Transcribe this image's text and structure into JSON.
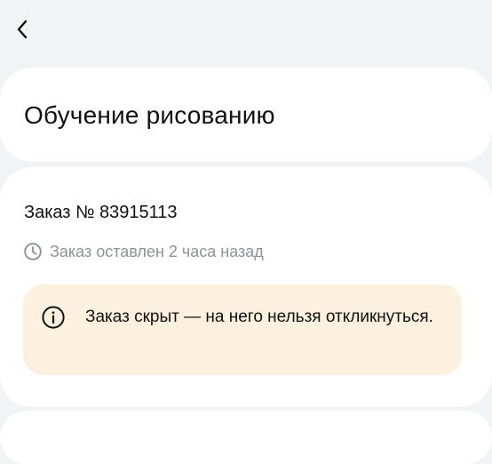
{
  "header": {
    "back_icon": "chevron-left-icon"
  },
  "title_card": {
    "title": "Обучение рисованию"
  },
  "order": {
    "number": "Заказ № 83915113",
    "posted_icon": "clock-icon",
    "posted": "Заказ оставлен 2 часа назад"
  },
  "notice": {
    "icon": "info-icon",
    "text": "Заказ скрыт — на него нельзя откликнуться.",
    "background": "#fbf1de"
  },
  "colors": {
    "page_background": "#f2f3f5",
    "card_background": "#ffffff",
    "muted_text": "#8e9196"
  }
}
